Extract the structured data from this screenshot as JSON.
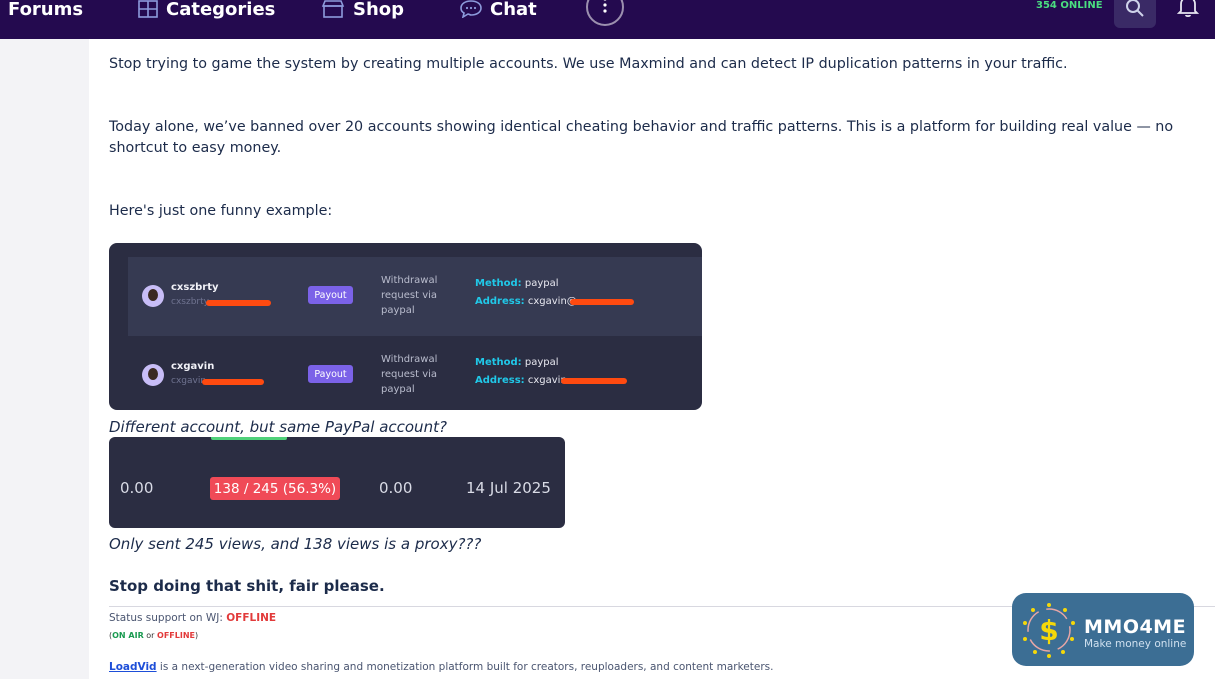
{
  "nav": {
    "forums": "Forums",
    "categories": "Categories",
    "shop": "Shop",
    "chat": "Chat",
    "online": "354 ONLINE"
  },
  "post": {
    "p1": "Stop trying to game the system by creating multiple accounts. We use Maxmind and can detect IP duplication patterns in your traffic.",
    "p2_line1": "Today alone, we’ve banned over 20 accounts showing identical cheating behavior and traffic patterns. This is a platform for building real value — no",
    "p2_line2": "shortcut to easy money.",
    "p3": "Here's just one funny example:",
    "withdrawals": [
      {
        "username": "cxszbrty",
        "sub": "cxszbrty",
        "badge": "Payout",
        "desc": "Withdrawal request via paypal",
        "method_label": "Method:",
        "method": "paypal",
        "address_label": "Address:",
        "address": "cxgavin@"
      },
      {
        "username": "cxgavin",
        "sub": "cxgavin",
        "badge": "Payout",
        "desc": "Withdrawal request via paypal",
        "method_label": "Method:",
        "method": "paypal",
        "address_label": "Address:",
        "address": "cxgavin"
      }
    ],
    "caption1": "Different account, but same PayPal account?",
    "stats": {
      "v1": "0.00",
      "badge": "138 / 245 (56.3%)",
      "v2": "0.00",
      "date": "14 Jul 2025"
    },
    "caption2": "Only sent 245 views, and 138 views is a proxy???",
    "closing": "Stop doing that shit, fair please."
  },
  "signature": {
    "status_prefix": "Status support on WJ:",
    "status_value": "OFFLINE",
    "legend_open": "(",
    "legend_on": "ON AIR",
    "legend_or": " or ",
    "legend_off": "OFFLINE",
    "legend_close": ")",
    "link_text": "LoadVid",
    "footer_text": " is a next-generation video sharing and monetization platform built for creators, reuploaders, and content marketers."
  },
  "watermark": {
    "title": "MMO4ME",
    "subtitle": "Make money online"
  },
  "colors": {
    "topbar": "#240a4f",
    "payout_badge": "#7b62e8",
    "proxy_badge": "#f04a57",
    "method_label": "#20c8e8",
    "online": "#4ade80"
  }
}
